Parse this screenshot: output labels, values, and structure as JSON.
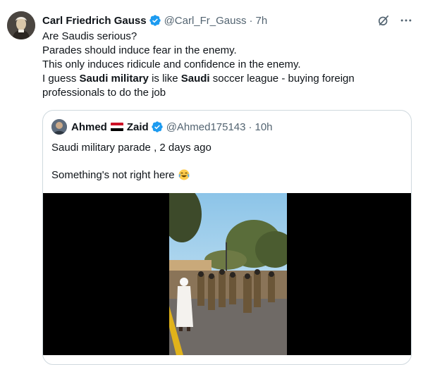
{
  "tweet": {
    "author_name": "Carl Friedrich Gauss",
    "handle": "@Carl_Fr_Gauss",
    "separator": "·",
    "time": "7h",
    "lines": {
      "l1": "Are Saudis serious?",
      "l2": "Parades should induce fear in the enemy.",
      "l3": "This only induces ridicule and confidence in the enemy.",
      "l4_a": "I guess ",
      "l4_b": "Saudi military",
      "l4_c": " is like ",
      "l4_d": "Saudi",
      "l4_e": " soccer league - buying foreign",
      "l5": "professionals to do the job"
    }
  },
  "quote": {
    "name_first": "Ahmed",
    "name_last": "Zaid",
    "handle": "@Ahmed175143",
    "separator": "·",
    "time": "10h",
    "text1": "Saudi military parade , 2 days ago",
    "text2": "Something's not right here",
    "emoji": "crying-laughing-emoji"
  },
  "icons": {
    "verified": "verified-badge-icon",
    "grok": "grok-icon",
    "more": "more-icon"
  },
  "colors": {
    "verified_blue": "#1d9bf0",
    "text": "#0f1419",
    "secondary": "#536471",
    "border": "#cfd9de"
  }
}
